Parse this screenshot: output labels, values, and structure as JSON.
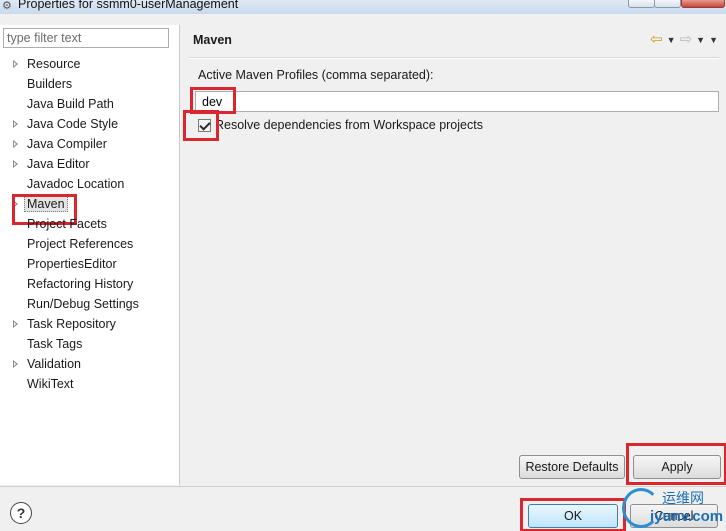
{
  "window": {
    "title": "Properties for ssmm0-userManagement"
  },
  "sidebar": {
    "filter_placeholder": "type filter text",
    "items": [
      {
        "label": "Resource",
        "expandable": true
      },
      {
        "label": "Builders",
        "expandable": false
      },
      {
        "label": "Java Build Path",
        "expandable": false
      },
      {
        "label": "Java Code Style",
        "expandable": true
      },
      {
        "label": "Java Compiler",
        "expandable": true
      },
      {
        "label": "Java Editor",
        "expandable": true
      },
      {
        "label": "Javadoc Location",
        "expandable": false
      },
      {
        "label": "Maven",
        "expandable": true,
        "selected": true
      },
      {
        "label": "Project Facets",
        "expandable": false
      },
      {
        "label": "Project References",
        "expandable": false
      },
      {
        "label": "PropertiesEditor",
        "expandable": false
      },
      {
        "label": "Refactoring History",
        "expandable": false
      },
      {
        "label": "Run/Debug Settings",
        "expandable": false
      },
      {
        "label": "Task Repository",
        "expandable": true
      },
      {
        "label": "Task Tags",
        "expandable": false
      },
      {
        "label": "Validation",
        "expandable": true
      },
      {
        "label": "WikiText",
        "expandable": false
      }
    ]
  },
  "page": {
    "title": "Maven",
    "profiles_label": "Active Maven Profiles (comma separated):",
    "profiles_value": "dev",
    "resolve_label": "Resolve dependencies from Workspace projects",
    "resolve_checked": true,
    "restore_defaults": "Restore Defaults",
    "apply": "Apply"
  },
  "footer": {
    "help_icon": "?",
    "ok": "OK",
    "cancel": "Cancel"
  },
  "watermark": {
    "cn": "运维网",
    "en": "iyunv.com"
  },
  "colors": {
    "highlight": "#d9262f",
    "selection": "#e4e4e4"
  }
}
